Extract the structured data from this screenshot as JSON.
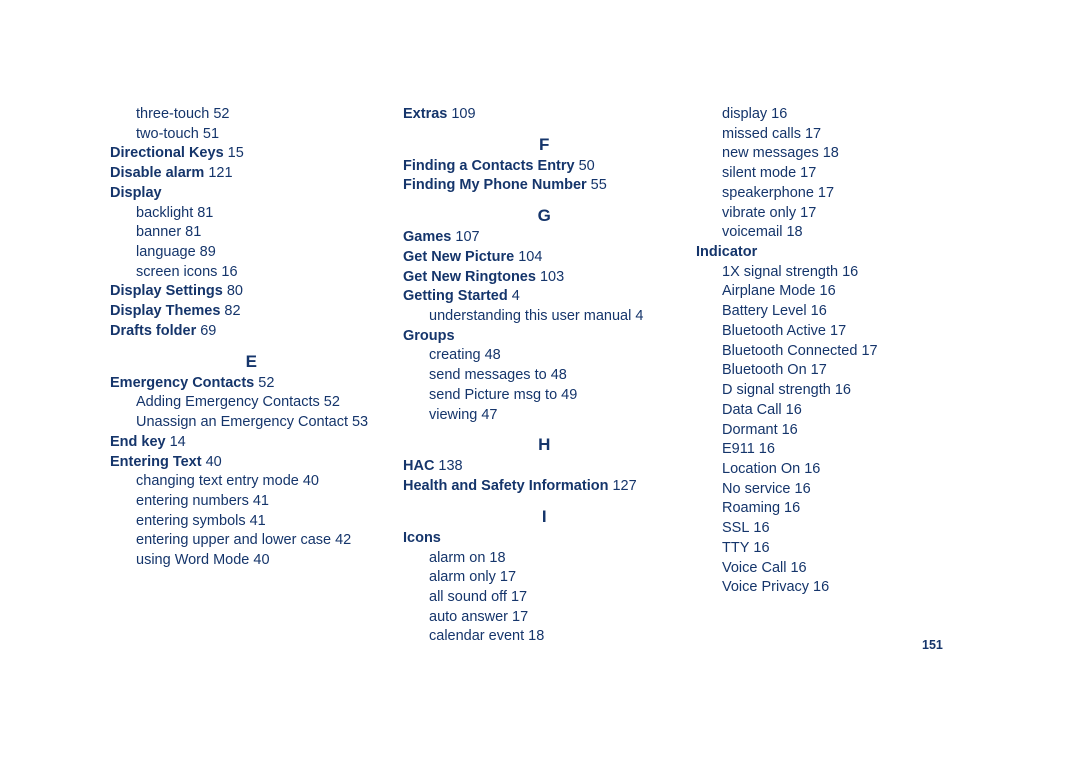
{
  "document": {
    "page_number": "151",
    "accent_color": "#15356b",
    "columns": [
      {
        "name": "column-1",
        "blocks": [
          {
            "type": "entry",
            "level": 1,
            "text": "three-touch",
            "page": "52"
          },
          {
            "type": "entry",
            "level": 1,
            "text": "two-touch",
            "page": "51"
          },
          {
            "type": "entry",
            "level": 0,
            "text": "Directional Keys",
            "page": "15"
          },
          {
            "type": "entry",
            "level": 0,
            "text": "Disable alarm",
            "page": "121"
          },
          {
            "type": "entry",
            "level": 0,
            "text": "Display",
            "page": ""
          },
          {
            "type": "entry",
            "level": 1,
            "text": "backlight",
            "page": "81"
          },
          {
            "type": "entry",
            "level": 1,
            "text": "banner",
            "page": "81"
          },
          {
            "type": "entry",
            "level": 1,
            "text": "language",
            "page": "89"
          },
          {
            "type": "entry",
            "level": 1,
            "text": "screen icons",
            "page": "16"
          },
          {
            "type": "entry",
            "level": 0,
            "text": "Display Settings",
            "page": "80"
          },
          {
            "type": "entry",
            "level": 0,
            "text": "Display Themes",
            "page": "82"
          },
          {
            "type": "entry",
            "level": 0,
            "text": "Drafts folder",
            "page": "69"
          },
          {
            "type": "letter",
            "text": "E"
          },
          {
            "type": "entry",
            "level": 0,
            "text": "Emergency Contacts",
            "page": "52"
          },
          {
            "type": "entry",
            "level": 1,
            "text": "Adding Emergency Contacts",
            "page": "52"
          },
          {
            "type": "entry",
            "level": 1,
            "text": "Unassign an Emergency Contact",
            "page": "53"
          },
          {
            "type": "entry",
            "level": 0,
            "text": "End key",
            "page": "14"
          },
          {
            "type": "entry",
            "level": 0,
            "text": "Entering Text",
            "page": "40"
          },
          {
            "type": "entry",
            "level": 1,
            "text": "changing text entry mode",
            "page": "40"
          },
          {
            "type": "entry",
            "level": 1,
            "text": "entering numbers",
            "page": "41"
          },
          {
            "type": "entry",
            "level": 1,
            "text": "entering symbols",
            "page": "41"
          },
          {
            "type": "entry",
            "level": 1,
            "text": "entering upper and lower case",
            "page": "42"
          },
          {
            "type": "entry",
            "level": 1,
            "text": "using Word Mode",
            "page": "40"
          }
        ]
      },
      {
        "name": "column-2",
        "blocks": [
          {
            "type": "entry",
            "level": 0,
            "text": "Extras",
            "page": "109"
          },
          {
            "type": "letter",
            "text": "F"
          },
          {
            "type": "entry",
            "level": 0,
            "text": "Finding a Contacts Entry",
            "page": "50"
          },
          {
            "type": "entry",
            "level": 0,
            "text": "Finding My Phone Number",
            "page": "55"
          },
          {
            "type": "letter",
            "text": "G"
          },
          {
            "type": "entry",
            "level": 0,
            "text": "Games",
            "page": "107"
          },
          {
            "type": "entry",
            "level": 0,
            "text": "Get New Picture",
            "page": "104"
          },
          {
            "type": "entry",
            "level": 0,
            "text": "Get New Ringtones",
            "page": "103"
          },
          {
            "type": "entry",
            "level": 0,
            "text": "Getting Started",
            "page": "4"
          },
          {
            "type": "entry",
            "level": 1,
            "text": "understanding this user manual",
            "page": "4"
          },
          {
            "type": "entry",
            "level": 0,
            "text": "Groups",
            "page": ""
          },
          {
            "type": "entry",
            "level": 1,
            "text": "creating",
            "page": "48"
          },
          {
            "type": "entry",
            "level": 1,
            "text": "send messages to",
            "page": "48"
          },
          {
            "type": "entry",
            "level": 1,
            "text": "send Picture msg to",
            "page": "49"
          },
          {
            "type": "entry",
            "level": 1,
            "text": "viewing",
            "page": "47"
          },
          {
            "type": "letter",
            "text": "H"
          },
          {
            "type": "entry",
            "level": 0,
            "text": "HAC",
            "page": "138"
          },
          {
            "type": "entry",
            "level": 0,
            "text": "Health and Safety Information",
            "page": "127"
          },
          {
            "type": "letter",
            "text": "I"
          },
          {
            "type": "entry",
            "level": 0,
            "text": "Icons",
            "page": ""
          },
          {
            "type": "entry",
            "level": 1,
            "text": "alarm on",
            "page": "18"
          },
          {
            "type": "entry",
            "level": 1,
            "text": "alarm only",
            "page": "17"
          },
          {
            "type": "entry",
            "level": 1,
            "text": "all sound off",
            "page": "17"
          },
          {
            "type": "entry",
            "level": 1,
            "text": "auto answer",
            "page": "17"
          },
          {
            "type": "entry",
            "level": 1,
            "text": "calendar event",
            "page": "18"
          }
        ]
      },
      {
        "name": "column-3",
        "blocks": [
          {
            "type": "entry",
            "level": 1,
            "text": "display",
            "page": "16"
          },
          {
            "type": "entry",
            "level": 1,
            "text": "missed calls",
            "page": "17"
          },
          {
            "type": "entry",
            "level": 1,
            "text": "new messages",
            "page": "18"
          },
          {
            "type": "entry",
            "level": 1,
            "text": "silent mode",
            "page": "17"
          },
          {
            "type": "entry",
            "level": 1,
            "text": "speakerphone",
            "page": "17"
          },
          {
            "type": "entry",
            "level": 1,
            "text": "vibrate only",
            "page": "17"
          },
          {
            "type": "entry",
            "level": 1,
            "text": "voicemail",
            "page": "18"
          },
          {
            "type": "entry",
            "level": 0,
            "text": "Indicator",
            "page": ""
          },
          {
            "type": "entry",
            "level": 1,
            "text": "1X signal strength",
            "page": "16"
          },
          {
            "type": "entry",
            "level": 1,
            "text": "Airplane Mode",
            "page": "16"
          },
          {
            "type": "entry",
            "level": 1,
            "text": "Battery Level",
            "page": "16"
          },
          {
            "type": "entry",
            "level": 1,
            "text": "Bluetooth Active",
            "page": "17"
          },
          {
            "type": "entry",
            "level": 1,
            "text": "Bluetooth Connected",
            "page": "17"
          },
          {
            "type": "entry",
            "level": 1,
            "text": "Bluetooth On",
            "page": "17"
          },
          {
            "type": "entry",
            "level": 1,
            "text": "D signal strength",
            "page": "16"
          },
          {
            "type": "entry",
            "level": 1,
            "text": "Data Call",
            "page": "16"
          },
          {
            "type": "entry",
            "level": 1,
            "text": "Dormant",
            "page": "16"
          },
          {
            "type": "entry",
            "level": 1,
            "text": "E911",
            "page": "16"
          },
          {
            "type": "entry",
            "level": 1,
            "text": "Location On",
            "page": "16"
          },
          {
            "type": "entry",
            "level": 1,
            "text": "No service",
            "page": "16"
          },
          {
            "type": "entry",
            "level": 1,
            "text": "Roaming",
            "page": "16"
          },
          {
            "type": "entry",
            "level": 1,
            "text": "SSL",
            "page": "16"
          },
          {
            "type": "entry",
            "level": 1,
            "text": "TTY",
            "page": "16"
          },
          {
            "type": "entry",
            "level": 1,
            "text": "Voice Call",
            "page": "16"
          },
          {
            "type": "entry",
            "level": 1,
            "text": "Voice Privacy",
            "page": "16"
          }
        ]
      }
    ]
  }
}
